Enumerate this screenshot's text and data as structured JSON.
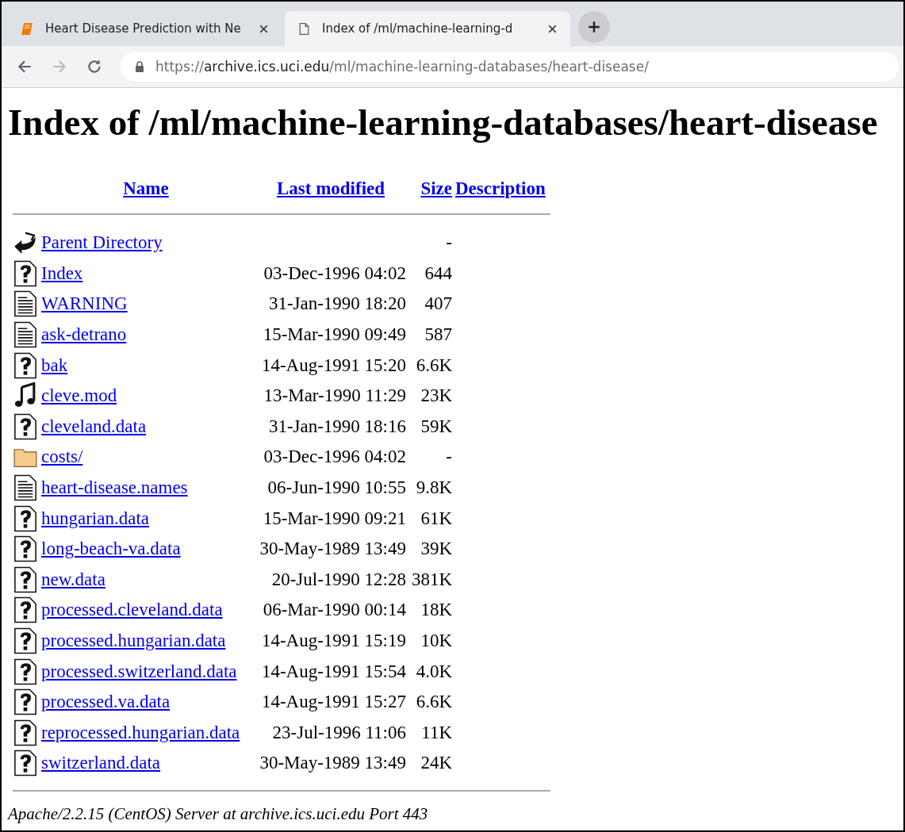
{
  "tabs": [
    {
      "title": "Heart Disease Prediction with Ne",
      "kind": "book",
      "selected": false
    },
    {
      "title": "Index of /ml/machine-learning-d",
      "kind": "page",
      "selected": true
    }
  ],
  "address_bar": {
    "scheme": "https://",
    "host": "archive.ics.uci.edu",
    "path": "/ml/machine-learning-databases/heart-disease/"
  },
  "page": {
    "heading": "Index of /ml/machine-learning-databases/heart-disease",
    "columns": [
      "Name",
      "Last modified",
      "Size",
      "Description"
    ],
    "rows": [
      {
        "kind": "back",
        "name": "Parent Directory",
        "modified": "",
        "size": "-"
      },
      {
        "kind": "unknown",
        "name": "Index",
        "modified": "03-Dec-1996 04:02",
        "size": "644"
      },
      {
        "kind": "text",
        "name": "WARNING",
        "modified": "31-Jan-1990 18:20",
        "size": "407"
      },
      {
        "kind": "text",
        "name": "ask-detrano",
        "modified": "15-Mar-1990 09:49",
        "size": "587"
      },
      {
        "kind": "unknown",
        "name": "bak",
        "modified": "14-Aug-1991 15:20",
        "size": "6.6K"
      },
      {
        "kind": "sound",
        "name": "cleve.mod",
        "modified": "13-Mar-1990 11:29",
        "size": "23K"
      },
      {
        "kind": "unknown",
        "name": "cleveland.data",
        "modified": "31-Jan-1990 18:16",
        "size": "59K"
      },
      {
        "kind": "folder",
        "name": "costs/",
        "modified": "03-Dec-1996 04:02",
        "size": "-"
      },
      {
        "kind": "text",
        "name": "heart-disease.names",
        "modified": "06-Jun-1990 10:55",
        "size": "9.8K"
      },
      {
        "kind": "unknown",
        "name": "hungarian.data",
        "modified": "15-Mar-1990 09:21",
        "size": "61K"
      },
      {
        "kind": "unknown",
        "name": "long-beach-va.data",
        "modified": "30-May-1989 13:49",
        "size": "39K"
      },
      {
        "kind": "unknown",
        "name": "new.data",
        "modified": "20-Jul-1990 12:28",
        "size": "381K"
      },
      {
        "kind": "unknown",
        "name": "processed.cleveland.data",
        "modified": "06-Mar-1990 00:14",
        "size": "18K"
      },
      {
        "kind": "unknown",
        "name": "processed.hungarian.data",
        "modified": "14-Aug-1991 15:19",
        "size": "10K"
      },
      {
        "kind": "unknown",
        "name": "processed.switzerland.data",
        "modified": "14-Aug-1991 15:54",
        "size": "4.0K"
      },
      {
        "kind": "unknown",
        "name": "processed.va.data",
        "modified": "14-Aug-1991 15:27",
        "size": "6.6K"
      },
      {
        "kind": "unknown",
        "name": "reprocessed.hungarian.data",
        "modified": "23-Jul-1996 11:06",
        "size": "11K"
      },
      {
        "kind": "unknown",
        "name": "switzerland.data",
        "modified": "30-May-1989 13:49",
        "size": "24K"
      }
    ],
    "footer": "Apache/2.2.15 (CentOS) Server at archive.ics.uci.edu Port 443"
  }
}
